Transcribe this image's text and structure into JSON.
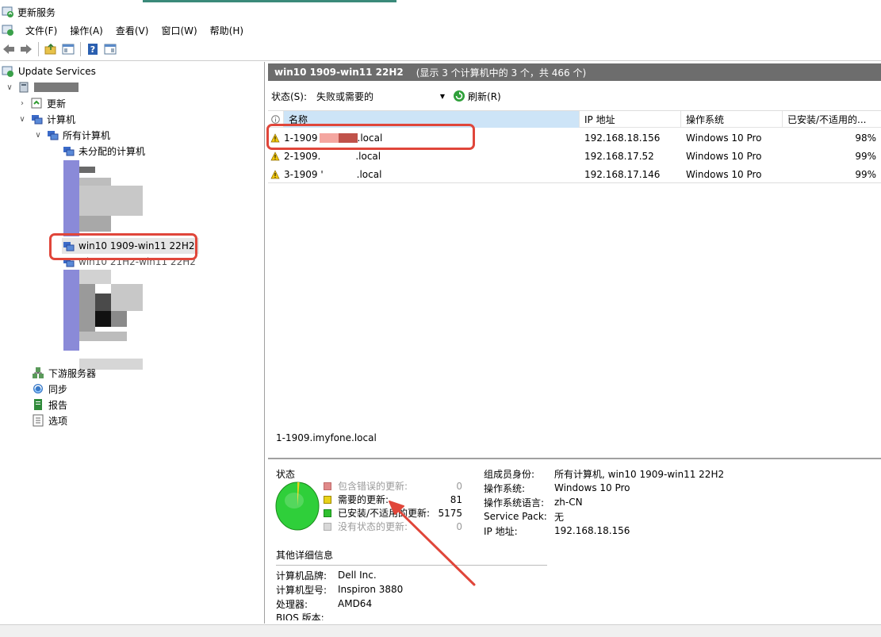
{
  "window": {
    "title": "更新服务"
  },
  "menubar": {
    "items": [
      "文件(F)",
      "操作(A)",
      "查看(V)",
      "窗口(W)",
      "帮助(H)"
    ]
  },
  "toolbar": {
    "buttons": [
      "back-icon",
      "forward-icon",
      "up-folder-icon",
      "show-hide-tree-icon",
      "help-icon",
      "properties-icon"
    ]
  },
  "tree": {
    "root": "Update Services",
    "nodes": {
      "updates": "更新",
      "computers": "计算机",
      "all_computers": "所有计算机",
      "unassigned": "未分配的计算机",
      "group_selected": "win10 1909-win11 22H2",
      "group_next": "win10 21H2-win11 22H2",
      "downstream": "下游服务器",
      "sync": "同步",
      "reports": "报告",
      "options": "选项"
    }
  },
  "header": {
    "title": "win10 1909-win11 22H2",
    "subtitle": "(显示 3 个计算机中的 3 个，共 466 个)"
  },
  "filter": {
    "label": "状态(S):",
    "value": "失败或需要的",
    "refresh_label": "刷新(R)"
  },
  "grid": {
    "columns": {
      "name": "名称",
      "ip": "IP 地址",
      "os": "操作系统",
      "pct": "已安装/不适用的..."
    },
    "rows": [
      {
        "name_prefix": "1-1909",
        "name_suffix": ".local",
        "ip": "192.168.18.156",
        "os": "Windows 10 Pro",
        "pct": "98%"
      },
      {
        "name_prefix": "2-1909.",
        "name_suffix": ".local",
        "ip": "192.168.17.52",
        "os": "Windows 10 Pro",
        "pct": "99%"
      },
      {
        "name_prefix": "3-1909 '",
        "name_suffix": ".local",
        "ip": "192.168.17.146",
        "os": "Windows 10 Pro",
        "pct": "99%"
      }
    ]
  },
  "detail": {
    "computer_name": "1-1909.imyfone.local",
    "status_title": "状态",
    "legend": [
      {
        "label": "包含错误的更新:",
        "value": "0",
        "color": "#e08a8a"
      },
      {
        "label": "需要的更新:",
        "value": "81",
        "color": "#e8d21a"
      },
      {
        "label": "已安装/不适用的更新:",
        "value": "5175",
        "color": "#2fbf2f"
      },
      {
        "label": "没有状态的更新:",
        "value": "0",
        "color": "#d8d8d8"
      }
    ],
    "pie": {
      "installed": 5175,
      "needed": 81,
      "failed": 0,
      "nostatus": 0,
      "installed_color": "#2fcf3a",
      "needed_color": "#e8d21a"
    },
    "props": {
      "membership": {
        "k": "组成员身份:",
        "v": "所有计算机, win10 1909-win11 22H2"
      },
      "os": {
        "k": "操作系统:",
        "v": "Windows 10 Pro"
      },
      "lang": {
        "k": "操作系统语言:",
        "v": "zh-CN"
      },
      "sp": {
        "k": "Service Pack:",
        "v": "无"
      },
      "ip": {
        "k": "IP 地址:",
        "v": "192.168.18.156"
      }
    },
    "other": {
      "title": "其他详细信息",
      "brand": {
        "k": "计算机品牌:",
        "v": "Dell Inc."
      },
      "model": {
        "k": "计算机型号:",
        "v": "Inspiron 3880"
      },
      "cpu": {
        "k": "处理器:",
        "v": "AMD64"
      },
      "bios": {
        "k": "BIOS 版本:"
      }
    }
  },
  "annotation": {
    "color": "#e0463a"
  }
}
